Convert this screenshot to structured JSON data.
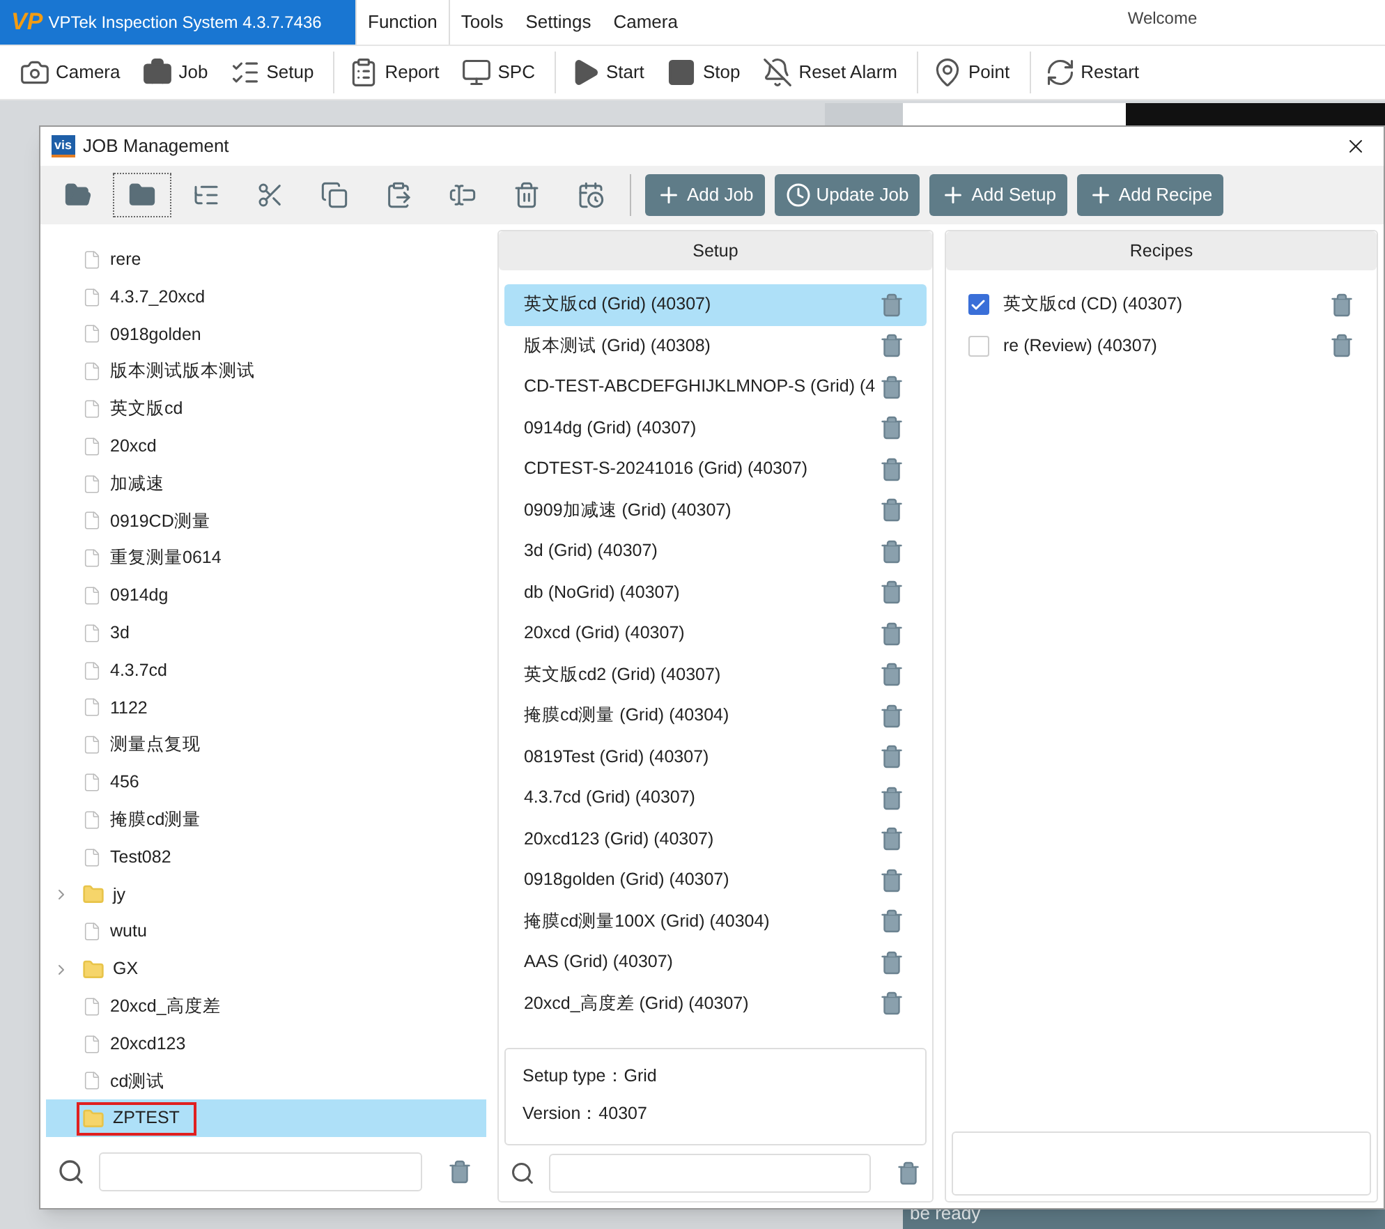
{
  "app": {
    "logo": "VP",
    "title": "VPTek Inspection System 4.3.7.7436",
    "welcome": "Welcome"
  },
  "menu": [
    {
      "label": "Function",
      "selected": true
    },
    {
      "label": "Tools",
      "selected": false
    },
    {
      "label": "Settings",
      "selected": false
    },
    {
      "label": "Camera",
      "selected": false
    }
  ],
  "toolbar": [
    {
      "kind": "camera",
      "label": "Camera"
    },
    {
      "kind": "job",
      "label": "Job"
    },
    {
      "kind": "setup",
      "label": "Setup"
    },
    {
      "kind": "report",
      "label": "Report"
    },
    {
      "kind": "spc",
      "label": "SPC"
    },
    {
      "kind": "start",
      "label": "Start"
    },
    {
      "kind": "stop",
      "label": "Stop"
    },
    {
      "kind": "alarm",
      "label": "Reset Alarm"
    },
    {
      "kind": "point",
      "label": "Point"
    },
    {
      "kind": "restart",
      "label": "Restart"
    }
  ],
  "status_bar": {
    "text": "be ready"
  },
  "dialog": {
    "logo": "vis",
    "title": "JOB Management",
    "tools": [
      {
        "kind": "open",
        "focused": false
      },
      {
        "kind": "folder",
        "focused": true
      },
      {
        "kind": "tree",
        "focused": false
      },
      {
        "kind": "cut",
        "focused": false
      },
      {
        "kind": "copy",
        "focused": false
      },
      {
        "kind": "paste",
        "focused": false
      },
      {
        "kind": "rename",
        "focused": false
      },
      {
        "kind": "delete",
        "focused": false
      },
      {
        "kind": "history",
        "focused": false
      }
    ],
    "actions": [
      {
        "kind": "add",
        "label": "Add Job"
      },
      {
        "kind": "update",
        "label": "Update Job"
      },
      {
        "kind": "add",
        "label": "Add Setup"
      },
      {
        "kind": "add",
        "label": "Add Recipe"
      }
    ],
    "jobs": [
      {
        "kind": "file",
        "name": "rere",
        "selected": false
      },
      {
        "kind": "file",
        "name": "4.3.7_20xcd",
        "selected": false
      },
      {
        "kind": "file",
        "name": "0918golden",
        "selected": false
      },
      {
        "kind": "file",
        "name": "版本测试版本测试",
        "selected": false
      },
      {
        "kind": "file",
        "name": "英文版cd",
        "selected": false
      },
      {
        "kind": "file",
        "name": "20xcd",
        "selected": false
      },
      {
        "kind": "file",
        "name": "加减速",
        "selected": false
      },
      {
        "kind": "file",
        "name": "0919CD测量",
        "selected": false
      },
      {
        "kind": "file",
        "name": "重复测量0614",
        "selected": false
      },
      {
        "kind": "file",
        "name": "0914dg",
        "selected": false
      },
      {
        "kind": "file",
        "name": "3d",
        "selected": false
      },
      {
        "kind": "file",
        "name": "4.3.7cd",
        "selected": false
      },
      {
        "kind": "file",
        "name": "1122",
        "selected": false
      },
      {
        "kind": "file",
        "name": "测量点复现",
        "selected": false
      },
      {
        "kind": "file",
        "name": "456",
        "selected": false
      },
      {
        "kind": "file",
        "name": "掩膜cd测量",
        "selected": false
      },
      {
        "kind": "file",
        "name": "Test082",
        "selected": false
      },
      {
        "kind": "folder",
        "name": "jy",
        "selected": false,
        "expanded": false
      },
      {
        "kind": "file",
        "name": "wutu",
        "selected": false
      },
      {
        "kind": "folder",
        "name": "GX",
        "selected": false,
        "expanded": false
      },
      {
        "kind": "file",
        "name": "20xcd_高度差",
        "selected": false
      },
      {
        "kind": "file",
        "name": "20xcd123",
        "selected": false
      },
      {
        "kind": "file",
        "name": "cd测试",
        "selected": false
      },
      {
        "kind": "folder",
        "name": "ZPTEST",
        "selected": true,
        "marked": true
      }
    ],
    "setup_header": "Setup",
    "setups": [
      {
        "name": "英文版cd (Grid) (40307)",
        "selected": true
      },
      {
        "name": "版本测试 (Grid) (40308)",
        "selected": false
      },
      {
        "name": "CD-TEST-ABCDEFGHIJKLMNOP-S (Grid) (4",
        "selected": false
      },
      {
        "name": "0914dg (Grid) (40307)",
        "selected": false
      },
      {
        "name": "CDTEST-S-20241016 (Grid) (40307)",
        "selected": false
      },
      {
        "name": "0909加减速 (Grid) (40307)",
        "selected": false
      },
      {
        "name": "3d (Grid) (40307)",
        "selected": false
      },
      {
        "name": "db (NoGrid) (40307)",
        "selected": false
      },
      {
        "name": "20xcd (Grid) (40307)",
        "selected": false
      },
      {
        "name": "英文版cd2 (Grid) (40307)",
        "selected": false
      },
      {
        "name": "掩膜cd测量 (Grid) (40304)",
        "selected": false
      },
      {
        "name": "0819Test (Grid) (40307)",
        "selected": false
      },
      {
        "name": "4.3.7cd (Grid) (40307)",
        "selected": false
      },
      {
        "name": "20xcd123 (Grid) (40307)",
        "selected": false
      },
      {
        "name": "0918golden (Grid) (40307)",
        "selected": false
      },
      {
        "name": "掩膜cd测量100X (Grid) (40304)",
        "selected": false
      },
      {
        "name": "AAS (Grid) (40307)",
        "selected": false
      },
      {
        "name": "20xcd_高度差 (Grid) (40307)",
        "selected": false
      }
    ],
    "setup_info": [
      "Setup type：Grid",
      "Version：40307"
    ],
    "recipes_header": "Recipes",
    "recipes": [
      {
        "name": "英文版cd (CD) (40307)",
        "checked": true
      },
      {
        "name": "re (Review) (40307)",
        "checked": false
      }
    ]
  }
}
